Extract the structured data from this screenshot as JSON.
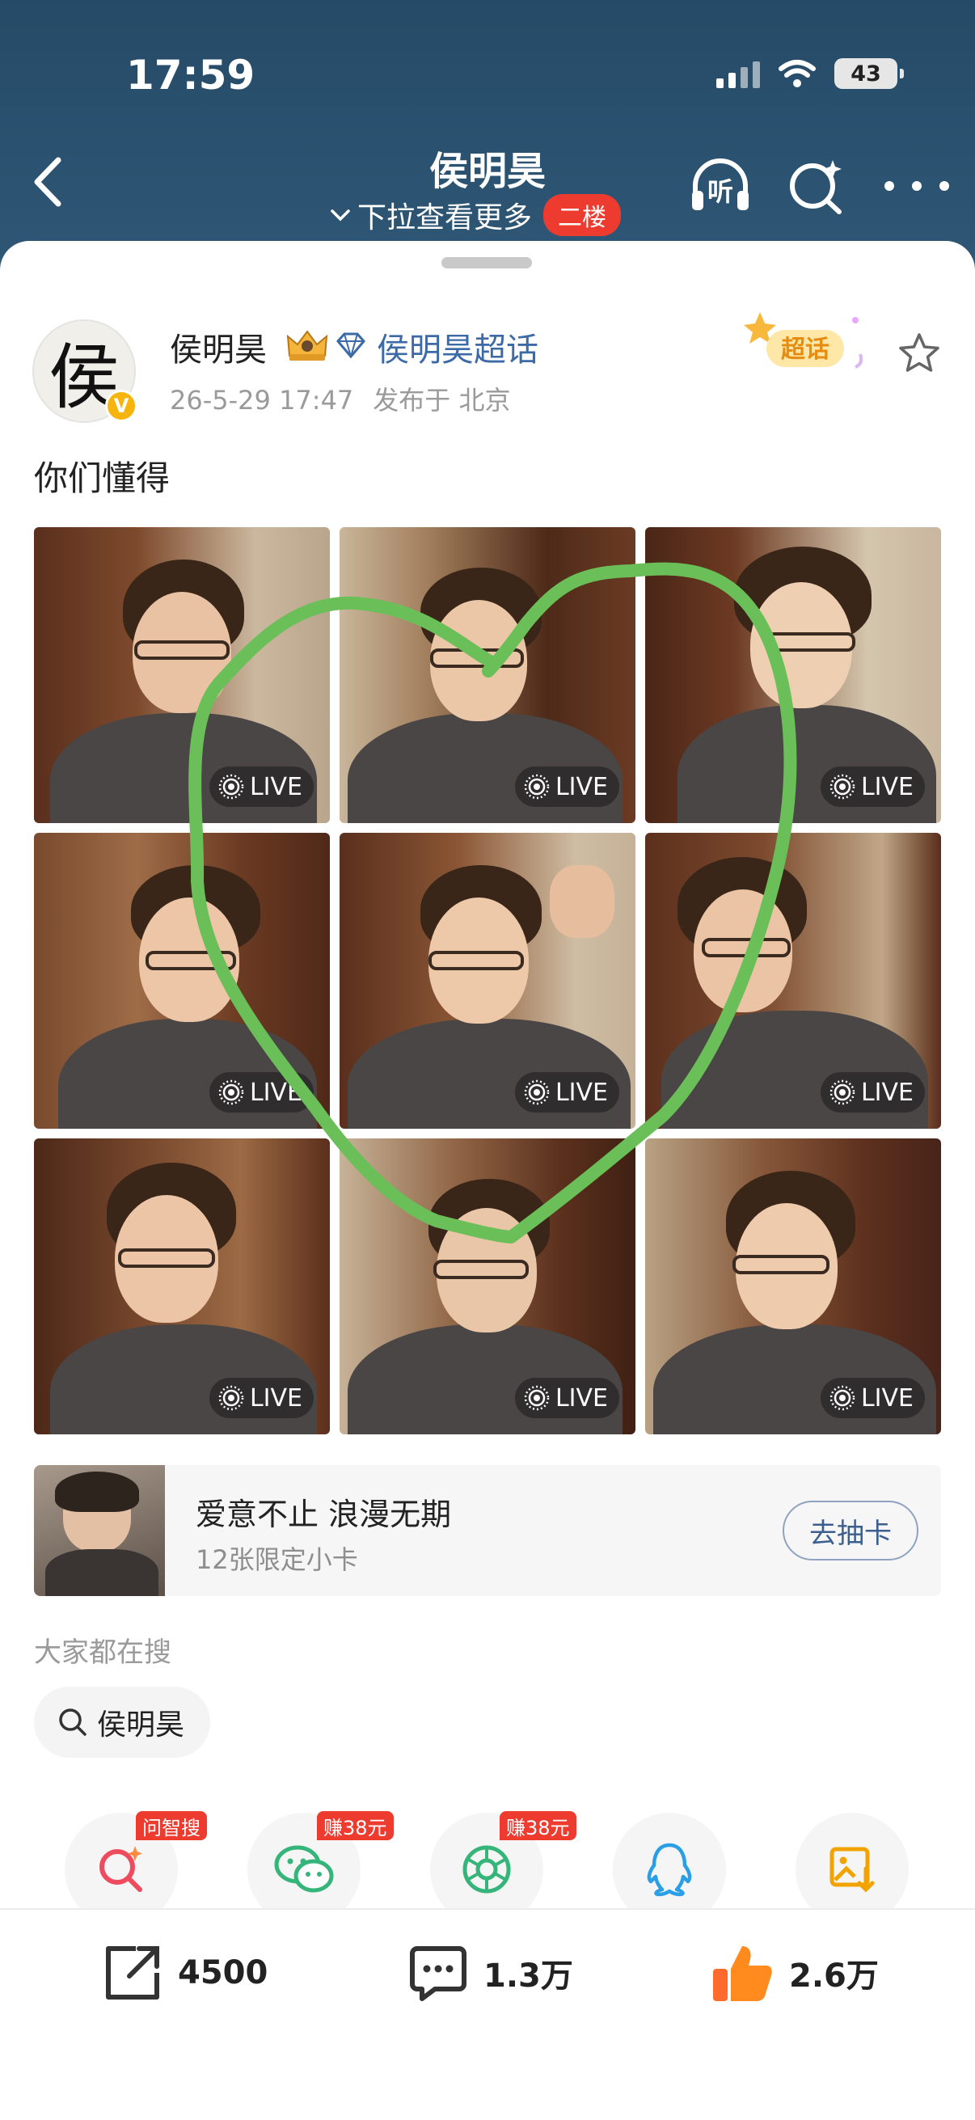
{
  "status_bar": {
    "time": "17:59",
    "battery": "43"
  },
  "nav": {
    "title": "侯明昊",
    "subtitle": "下拉查看更多",
    "floor_badge": "二楼",
    "listen_label": "听"
  },
  "post": {
    "author": "侯明昊",
    "avatar_char": "侯",
    "verified_label": "V",
    "topic": "侯明昊超话",
    "date": "26-5-29 17:47",
    "location": "发布于 北京",
    "supertopic_badge": "超话",
    "text": "你们懂得",
    "photos": [
      {
        "label": "LIVE"
      },
      {
        "label": "LIVE"
      },
      {
        "label": "LIVE"
      },
      {
        "label": "LIVE"
      },
      {
        "label": "LIVE"
      },
      {
        "label": "LIVE"
      },
      {
        "label": "LIVE"
      },
      {
        "label": "LIVE"
      },
      {
        "label": "LIVE"
      }
    ]
  },
  "promo": {
    "title": "爱意不止 浪漫无期",
    "subtitle": "12张限定小卡",
    "button": "去抽卡"
  },
  "trending": {
    "heading": "大家都在搜",
    "chip": "侯明昊"
  },
  "share": {
    "items": [
      {
        "icon": "ask-search-icon",
        "tag": "问智搜"
      },
      {
        "icon": "wechat-icon",
        "tag": "赚38元"
      },
      {
        "icon": "moments-icon",
        "tag": "赚38元"
      },
      {
        "icon": "qq-icon",
        "tag": ""
      },
      {
        "icon": "save-image-icon",
        "tag": ""
      }
    ]
  },
  "actions": {
    "repost": "4500",
    "comment": "1.3万",
    "like": "2.6万"
  },
  "colors": {
    "header": "#254a67",
    "link": "#3c6aa7",
    "heart_stroke": "#6abf58",
    "badge_red": "#ee3b2f"
  }
}
